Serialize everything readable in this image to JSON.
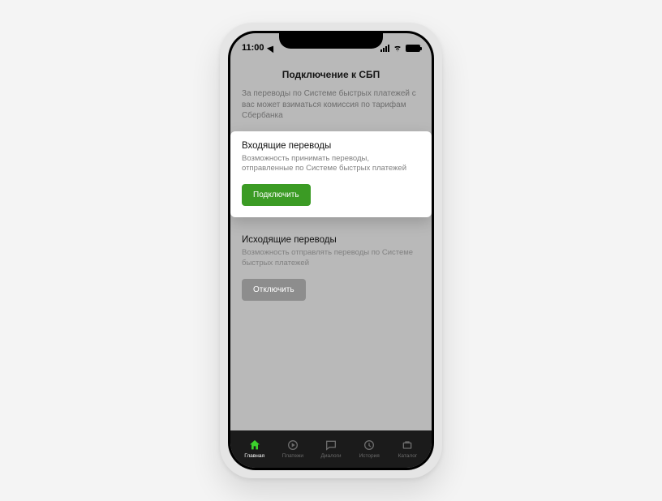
{
  "statusbar": {
    "time": "11:00"
  },
  "header": {
    "title": "Подключение к СБП"
  },
  "notice": "За переводы по Системе быстрых платежей с вас может взиматься комиссия по тарифам Сбербанка",
  "cards": {
    "incoming": {
      "title": "Входящие переводы",
      "desc": "Возможность принимать переводы, отправленные по Системе быстрых платежей",
      "button": "Подключить"
    },
    "outgoing": {
      "title": "Исходящие переводы",
      "desc": "Возможность отправлять переводы по Системе быстрых платежей",
      "button": "Отключить"
    }
  },
  "tabs": [
    {
      "label": "Главная"
    },
    {
      "label": "Платежи"
    },
    {
      "label": "Диалоги"
    },
    {
      "label": "История"
    },
    {
      "label": "Каталог"
    }
  ],
  "colors": {
    "accent": "#3b9b24",
    "tab_active": "#3bd12b"
  }
}
